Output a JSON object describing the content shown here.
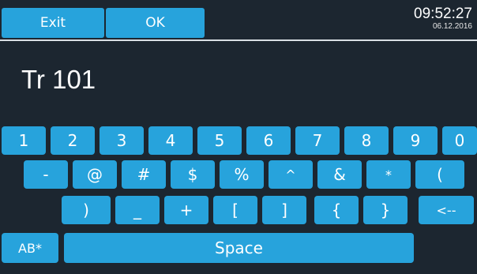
{
  "top_bar": {
    "exit_label": "Exit",
    "ok_label": "OK",
    "time": "09:52:27",
    "date": "06.12.2016"
  },
  "input": {
    "value": "Tr 101"
  },
  "keyboard": {
    "row1": [
      "1",
      "2",
      "3",
      "4",
      "5",
      "6",
      "7",
      "8",
      "9",
      "0"
    ],
    "row2": [
      "-",
      "@",
      "#",
      "$",
      "%",
      "^",
      "&",
      "*",
      "("
    ],
    "row3": [
      ")",
      "_",
      "+",
      "[",
      "]",
      "{",
      "}",
      "<--"
    ],
    "row4": {
      "mode_label": "AB*",
      "space_label": "Space"
    }
  },
  "colors": {
    "background": "#1c2630",
    "key": "#27a3dc",
    "text": "#ffffff"
  }
}
